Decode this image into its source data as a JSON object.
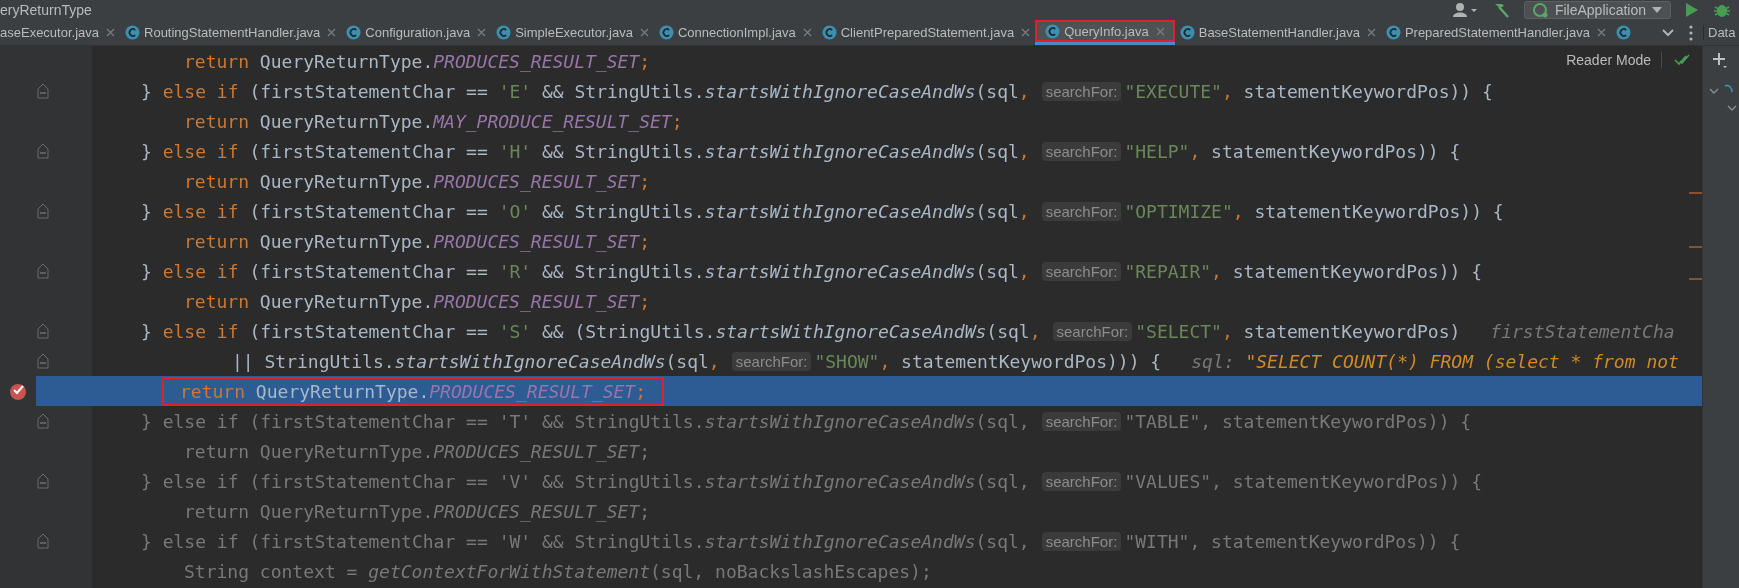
{
  "title_bar": {
    "title": "eryReturnType",
    "run_config": "FileApplication"
  },
  "tabs": [
    {
      "label": "aseExecutor.java",
      "icon": false,
      "closable": true,
      "selected": false,
      "annotated": false
    },
    {
      "label": "RoutingStatementHandler.java",
      "icon": true,
      "closable": true,
      "selected": false,
      "annotated": false
    },
    {
      "label": "Configuration.java",
      "icon": true,
      "closable": true,
      "selected": false,
      "annotated": false
    },
    {
      "label": "SimpleExecutor.java",
      "icon": true,
      "closable": true,
      "selected": false,
      "annotated": false
    },
    {
      "label": "ConnectionImpl.java",
      "icon": true,
      "closable": true,
      "selected": false,
      "annotated": false
    },
    {
      "label": "ClientPreparedStatement.java",
      "icon": true,
      "closable": true,
      "selected": false,
      "annotated": false
    },
    {
      "label": "QueryInfo.java",
      "icon": true,
      "closable": true,
      "selected": true,
      "annotated": true
    },
    {
      "label": "BaseStatementHandler.java",
      "icon": true,
      "closable": true,
      "selected": false,
      "annotated": false
    },
    {
      "label": "PreparedStatementHandler.java",
      "icon": true,
      "closable": true,
      "selected": false,
      "annotated": false
    },
    {
      "icon": true,
      "closable": false,
      "selected": false,
      "annotated": false
    }
  ],
  "side_panel": {
    "title": "Data"
  },
  "editor": {
    "reader_mode": "Reader Mode",
    "lines": [
      {
        "kind": "body",
        "fold": false,
        "breakpoint": false,
        "selected": false,
        "dimmed": false,
        "annotated": false,
        "segments": [
          {
            "kind": "code",
            "tokens": [
              {
                "kind": "kw",
                "text": "return"
              },
              {
                "kind": "p",
                "text": " QueryReturnType."
              },
              {
                "kind": "const",
                "text": "PRODUCES_RESULT_SET"
              },
              {
                "kind": "kw",
                "text": ";"
              }
            ]
          }
        ]
      },
      {
        "kind": "branch",
        "fold": true,
        "breakpoint": false,
        "selected": false,
        "dimmed": false,
        "annotated": false,
        "segments": [
          {
            "kind": "code",
            "tokens": [
              {
                "kind": "p",
                "text": "} "
              },
              {
                "kind": "kw",
                "text": "else if"
              },
              {
                "kind": "p",
                "text": " (firstStatementChar == "
              },
              {
                "kind": "str",
                "text": "'E'"
              },
              {
                "kind": "p",
                "text": " && StringUtils."
              },
              {
                "kind": "method",
                "text": "startsWithIgnoreCaseAndWs"
              },
              {
                "kind": "p",
                "text": "(sql"
              },
              {
                "kind": "kw",
                "text": ","
              }
            ]
          },
          {
            "kind": "hint",
            "text": "searchFor:"
          },
          {
            "kind": "code",
            "tokens": [
              {
                "kind": "str",
                "text": "\"EXECUTE\""
              },
              {
                "kind": "kw",
                "text": ","
              },
              {
                "kind": "p",
                "text": " statementKeywordPos)) {"
              }
            ]
          }
        ]
      },
      {
        "kind": "body",
        "fold": false,
        "breakpoint": false,
        "selected": false,
        "dimmed": false,
        "annotated": false,
        "segments": [
          {
            "kind": "code",
            "tokens": [
              {
                "kind": "kw",
                "text": "return"
              },
              {
                "kind": "p",
                "text": " QueryReturnType."
              },
              {
                "kind": "const",
                "text": "MAY_PRODUCE_RESULT_SET"
              },
              {
                "kind": "kw",
                "text": ";"
              }
            ]
          }
        ]
      },
      {
        "kind": "branch",
        "fold": true,
        "breakpoint": false,
        "selected": false,
        "dimmed": false,
        "annotated": false,
        "segments": [
          {
            "kind": "code",
            "tokens": [
              {
                "kind": "p",
                "text": "} "
              },
              {
                "kind": "kw",
                "text": "else if"
              },
              {
                "kind": "p",
                "text": " (firstStatementChar == "
              },
              {
                "kind": "str",
                "text": "'H'"
              },
              {
                "kind": "p",
                "text": " && StringUtils."
              },
              {
                "kind": "method",
                "text": "startsWithIgnoreCaseAndWs"
              },
              {
                "kind": "p",
                "text": "(sql"
              },
              {
                "kind": "kw",
                "text": ","
              }
            ]
          },
          {
            "kind": "hint",
            "text": "searchFor:"
          },
          {
            "kind": "code",
            "tokens": [
              {
                "kind": "str",
                "text": "\"HELP\""
              },
              {
                "kind": "kw",
                "text": ","
              },
              {
                "kind": "p",
                "text": " statementKeywordPos)) {"
              }
            ]
          }
        ]
      },
      {
        "kind": "body",
        "fold": false,
        "breakpoint": false,
        "selected": false,
        "dimmed": false,
        "annotated": false,
        "segments": [
          {
            "kind": "code",
            "tokens": [
              {
                "kind": "kw",
                "text": "return"
              },
              {
                "kind": "p",
                "text": " QueryReturnType."
              },
              {
                "kind": "const",
                "text": "PRODUCES_RESULT_SET"
              },
              {
                "kind": "kw",
                "text": ";"
              }
            ]
          }
        ]
      },
      {
        "kind": "branch",
        "fold": true,
        "breakpoint": false,
        "selected": false,
        "dimmed": false,
        "annotated": false,
        "segments": [
          {
            "kind": "code",
            "tokens": [
              {
                "kind": "p",
                "text": "} "
              },
              {
                "kind": "kw",
                "text": "else if"
              },
              {
                "kind": "p",
                "text": " (firstStatementChar == "
              },
              {
                "kind": "str",
                "text": "'O'"
              },
              {
                "kind": "p",
                "text": " && StringUtils."
              },
              {
                "kind": "method",
                "text": "startsWithIgnoreCaseAndWs"
              },
              {
                "kind": "p",
                "text": "(sql"
              },
              {
                "kind": "kw",
                "text": ","
              }
            ]
          },
          {
            "kind": "hint",
            "text": "searchFor:"
          },
          {
            "kind": "code",
            "tokens": [
              {
                "kind": "str",
                "text": "\"OPTIMIZE\""
              },
              {
                "kind": "kw",
                "text": ","
              },
              {
                "kind": "p",
                "text": " statementKeywordPos)) {"
              }
            ]
          }
        ]
      },
      {
        "kind": "body",
        "fold": false,
        "breakpoint": false,
        "selected": false,
        "dimmed": false,
        "annotated": false,
        "segments": [
          {
            "kind": "code",
            "tokens": [
              {
                "kind": "kw",
                "text": "return"
              },
              {
                "kind": "p",
                "text": " QueryReturnType."
              },
              {
                "kind": "const",
                "text": "PRODUCES_RESULT_SET"
              },
              {
                "kind": "kw",
                "text": ";"
              }
            ]
          }
        ]
      },
      {
        "kind": "branch",
        "fold": true,
        "breakpoint": false,
        "selected": false,
        "dimmed": false,
        "annotated": false,
        "segments": [
          {
            "kind": "code",
            "tokens": [
              {
                "kind": "p",
                "text": "} "
              },
              {
                "kind": "kw",
                "text": "else if"
              },
              {
                "kind": "p",
                "text": " (firstStatementChar == "
              },
              {
                "kind": "str",
                "text": "'R'"
              },
              {
                "kind": "p",
                "text": " && StringUtils."
              },
              {
                "kind": "method",
                "text": "startsWithIgnoreCaseAndWs"
              },
              {
                "kind": "p",
                "text": "(sql"
              },
              {
                "kind": "kw",
                "text": ","
              }
            ]
          },
          {
            "kind": "hint",
            "text": "searchFor:"
          },
          {
            "kind": "code",
            "tokens": [
              {
                "kind": "str",
                "text": "\"REPAIR\""
              },
              {
                "kind": "kw",
                "text": ","
              },
              {
                "kind": "p",
                "text": " statementKeywordPos)) {"
              }
            ]
          }
        ]
      },
      {
        "kind": "body",
        "fold": false,
        "breakpoint": false,
        "selected": false,
        "dimmed": false,
        "annotated": false,
        "segments": [
          {
            "kind": "code",
            "tokens": [
              {
                "kind": "kw",
                "text": "return"
              },
              {
                "kind": "p",
                "text": " QueryReturnType."
              },
              {
                "kind": "const",
                "text": "PRODUCES_RESULT_SET"
              },
              {
                "kind": "kw",
                "text": ";"
              }
            ]
          }
        ]
      },
      {
        "kind": "branch",
        "fold": true,
        "breakpoint": false,
        "selected": false,
        "dimmed": false,
        "annotated": false,
        "segments": [
          {
            "kind": "code",
            "tokens": [
              {
                "kind": "p",
                "text": "} "
              },
              {
                "kind": "kw",
                "text": "else if"
              },
              {
                "kind": "p",
                "text": " (firstStatementChar == "
              },
              {
                "kind": "str",
                "text": "'S'"
              },
              {
                "kind": "p",
                "text": " && (StringUtils."
              },
              {
                "kind": "method",
                "text": "startsWithIgnoreCaseAndWs"
              },
              {
                "kind": "p",
                "text": "(sql"
              },
              {
                "kind": "kw",
                "text": ","
              }
            ]
          },
          {
            "kind": "hint",
            "text": "searchFor:"
          },
          {
            "kind": "code",
            "tokens": [
              {
                "kind": "str",
                "text": "\"SELECT\""
              },
              {
                "kind": "kw",
                "text": ","
              },
              {
                "kind": "p",
                "text": " statementKeywordPos)"
              }
            ]
          },
          {
            "kind": "debug",
            "tokens": [
              {
                "kind": "dn",
                "text": "firstStatementCha"
              }
            ]
          }
        ]
      },
      {
        "kind": "continuation",
        "fold": true,
        "breakpoint": false,
        "selected": false,
        "dimmed": false,
        "annotated": false,
        "segments": [
          {
            "kind": "code",
            "tokens": [
              {
                "kind": "p",
                "text": "|| StringUtils."
              },
              {
                "kind": "method",
                "text": "startsWithIgnoreCaseAndWs"
              },
              {
                "kind": "p",
                "text": "(sql"
              },
              {
                "kind": "kw",
                "text": ","
              }
            ]
          },
          {
            "kind": "hint",
            "text": "searchFor:"
          },
          {
            "kind": "code",
            "tokens": [
              {
                "kind": "str",
                "text": "\"SHOW\""
              },
              {
                "kind": "kw",
                "text": ","
              },
              {
                "kind": "p",
                "text": " statementKeywordPos))) {"
              }
            ]
          },
          {
            "kind": "debug",
            "tokens": [
              {
                "kind": "dn",
                "text": "sql:"
              },
              {
                "kind": "dv",
                "text": " \"SELECT COUNT(*) FROM (select * from not"
              }
            ]
          }
        ]
      },
      {
        "kind": "body",
        "fold": false,
        "breakpoint": true,
        "selected": true,
        "dimmed": false,
        "annotated": true,
        "segments": [
          {
            "kind": "code",
            "tokens": [
              {
                "kind": "kw",
                "text": "return"
              },
              {
                "kind": "p",
                "text": " QueryReturnType."
              },
              {
                "kind": "const",
                "text": "PRODUCES_RESULT_SET"
              },
              {
                "kind": "kw",
                "text": ";"
              }
            ]
          }
        ]
      },
      {
        "kind": "branch",
        "fold": true,
        "breakpoint": false,
        "selected": false,
        "dimmed": true,
        "annotated": false,
        "segments": [
          {
            "kind": "code",
            "tokens": [
              {
                "kind": "p",
                "text": "} "
              },
              {
                "kind": "kw",
                "text": "else if"
              },
              {
                "kind": "p",
                "text": " (firstStatementChar == "
              },
              {
                "kind": "str",
                "text": "'T'"
              },
              {
                "kind": "p",
                "text": " && StringUtils."
              },
              {
                "kind": "method",
                "text": "startsWithIgnoreCaseAndWs"
              },
              {
                "kind": "p",
                "text": "(sql"
              },
              {
                "kind": "kw",
                "text": ","
              }
            ]
          },
          {
            "kind": "hint",
            "text": "searchFor:"
          },
          {
            "kind": "code",
            "tokens": [
              {
                "kind": "str",
                "text": "\"TABLE\""
              },
              {
                "kind": "kw",
                "text": ","
              },
              {
                "kind": "p",
                "text": " statementKeywordPos)) {"
              }
            ]
          }
        ]
      },
      {
        "kind": "body",
        "fold": false,
        "breakpoint": false,
        "selected": false,
        "dimmed": true,
        "annotated": false,
        "segments": [
          {
            "kind": "code",
            "tokens": [
              {
                "kind": "kw",
                "text": "return"
              },
              {
                "kind": "p",
                "text": " QueryReturnType."
              },
              {
                "kind": "const",
                "text": "PRODUCES_RESULT_SET"
              },
              {
                "kind": "kw",
                "text": ";"
              }
            ]
          }
        ]
      },
      {
        "kind": "branch",
        "fold": true,
        "breakpoint": false,
        "selected": false,
        "dimmed": true,
        "annotated": false,
        "segments": [
          {
            "kind": "code",
            "tokens": [
              {
                "kind": "p",
                "text": "} "
              },
              {
                "kind": "kw",
                "text": "else if"
              },
              {
                "kind": "p",
                "text": " (firstStatementChar == "
              },
              {
                "kind": "str",
                "text": "'V'"
              },
              {
                "kind": "p",
                "text": " && StringUtils."
              },
              {
                "kind": "method",
                "text": "startsWithIgnoreCaseAndWs"
              },
              {
                "kind": "p",
                "text": "(sql"
              },
              {
                "kind": "kw",
                "text": ","
              }
            ]
          },
          {
            "kind": "hint",
            "text": "searchFor:"
          },
          {
            "kind": "code",
            "tokens": [
              {
                "kind": "str",
                "text": "\"VALUES\""
              },
              {
                "kind": "kw",
                "text": ","
              },
              {
                "kind": "p",
                "text": " statementKeywordPos)) {"
              }
            ]
          }
        ]
      },
      {
        "kind": "body",
        "fold": false,
        "breakpoint": false,
        "selected": false,
        "dimmed": true,
        "annotated": false,
        "segments": [
          {
            "kind": "code",
            "tokens": [
              {
                "kind": "kw",
                "text": "return"
              },
              {
                "kind": "p",
                "text": " QueryReturnType."
              },
              {
                "kind": "const",
                "text": "PRODUCES_RESULT_SET"
              },
              {
                "kind": "kw",
                "text": ";"
              }
            ]
          }
        ]
      },
      {
        "kind": "branch",
        "fold": true,
        "breakpoint": false,
        "selected": false,
        "dimmed": true,
        "annotated": false,
        "segments": [
          {
            "kind": "code",
            "tokens": [
              {
                "kind": "p",
                "text": "} "
              },
              {
                "kind": "kw",
                "text": "else if"
              },
              {
                "kind": "p",
                "text": " (firstStatementChar == "
              },
              {
                "kind": "str",
                "text": "'W'"
              },
              {
                "kind": "p",
                "text": " && StringUtils."
              },
              {
                "kind": "method",
                "text": "startsWithIgnoreCaseAndWs"
              },
              {
                "kind": "p",
                "text": "(sql"
              },
              {
                "kind": "kw",
                "text": ","
              }
            ]
          },
          {
            "kind": "hint",
            "text": "searchFor:"
          },
          {
            "kind": "code",
            "tokens": [
              {
                "kind": "str",
                "text": "\"WITH\""
              },
              {
                "kind": "kw",
                "text": ","
              },
              {
                "kind": "p",
                "text": " statementKeywordPos)) {"
              }
            ]
          }
        ]
      },
      {
        "kind": "body",
        "fold": false,
        "breakpoint": false,
        "selected": false,
        "dimmed": true,
        "annotated": false,
        "segments": [
          {
            "kind": "code",
            "tokens": [
              {
                "kind": "p",
                "text": "String context = "
              },
              {
                "kind": "method",
                "text": "getContextForWithStatement"
              },
              {
                "kind": "p",
                "text": "(sql"
              },
              {
                "kind": "kw",
                "text": ","
              },
              {
                "kind": "p",
                "text": " noBackslashEscapes)"
              },
              {
                "kind": "kw",
                "text": ";"
              }
            ]
          }
        ]
      }
    ]
  }
}
